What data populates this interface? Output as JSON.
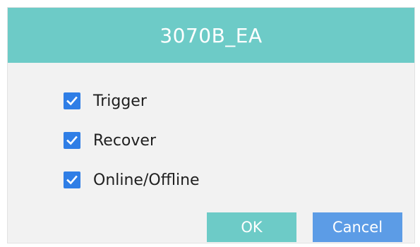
{
  "dialog": {
    "title": "3070B_EA"
  },
  "options": [
    {
      "label": "Trigger",
      "checked": true,
      "icon": "checkmark-icon"
    },
    {
      "label": "Recover",
      "checked": true,
      "icon": "checkmark-icon"
    },
    {
      "label": "Online/Offline",
      "checked": true,
      "icon": "checkmark-icon"
    }
  ],
  "buttons": {
    "ok_label": "OK",
    "cancel_label": "Cancel"
  },
  "colors": {
    "header": "#6dcbc7",
    "checkbox": "#2f7ee6",
    "ok_button": "#6dcbc7",
    "cancel_button": "#5c9ce6",
    "dialog_background": "#f2f2f2"
  }
}
